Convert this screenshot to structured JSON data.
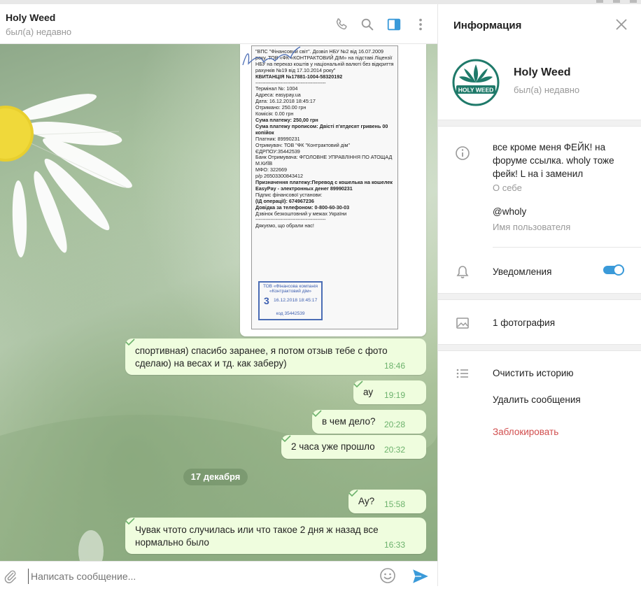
{
  "chat": {
    "title": "Holy Weed",
    "status": "был(а) недавно"
  },
  "receipt": {
    "lines": [
      "\"ВПС \"Фінансовий світ\". Дозвіл НБУ №2 від 16.07.2009 року. ТОВ «ФК «КОНТРАКТОВИЙ ДІМ» на підставі Ліцензії НБУ на переказ коштів у національній валюті без відкриття рахунків №19 від 17.10.2014 року\"",
      "КВИТАНЦІЯ №17881-1004-58320192",
      "------------------------------------------",
      "Термінал №: 1004",
      "Адреса: easypay.ua",
      "Дата: 16.12.2018 18:45:17",
      "Отримано: 250.00 грн",
      "Комісія: 0.00 грн",
      "Сума платежу: 250,00 грн",
      "Сума платежу прописом: Двісті п'ятдесят гривень 00 копійок",
      "Платник: 89990231",
      "Отримувач: ТОВ \"ФК \"Контрактовий дім\"",
      "ЄДРПОУ:35442539",
      "Банк Отримувача: ФГОЛОВНЕ УПРАВЛІННЯ ПО АТОЩАД М.КИЇВ",
      "МФО: 322669",
      "р/р 26503300843412",
      "Призначення платежу:Перевод с кошелька на кошелек EasyPay - электронных денег 89990231",
      "Підпис фінансової установи:",
      "(ІД операції): 674967236",
      "Довідка за телефоном: 0-800-60-30-03",
      "Дзвінок безкоштовний у межах України",
      "------------------------------------------",
      "Дякуємо, що обрали нас!"
    ],
    "stamp_head": "ТОВ «Фінансова компанія «Контрактовий дім»",
    "stamp_num": "3",
    "stamp_date": "16.12.2018 18:45:17",
    "stamp_code": "код 35442539"
  },
  "messages": [
    {
      "text": "спортивная) спасибо заранее, я потом отзыв тебе с фото сделаю) на весах и тд. как заберу)",
      "time": "18:46"
    },
    {
      "text": "ау",
      "time": "19:19"
    },
    {
      "text": "в чем дело?",
      "time": "20:28"
    },
    {
      "text": "2 часа уже прошло",
      "time": "20:32"
    },
    {
      "text": "Ау?",
      "time": "15:58"
    },
    {
      "text": "Чувак чтото случилась или что такое 2 дня ж назад все нормально было",
      "time": "16:33"
    }
  ],
  "date_separator": "17 декабря",
  "composer": {
    "placeholder": "Написать сообщение..."
  },
  "info": {
    "title": "Информация",
    "name": "Holy Weed",
    "status": "был(а) недавно",
    "logo_text": "HOLY WEED",
    "about": "все кроме меня ФЕЙК! на форуме ссылка. wholy тоже фейк! L на i заменил",
    "about_label": "О себе",
    "username": "@wholy",
    "username_label": "Имя пользователя",
    "notifications": "Уведомления",
    "notifications_on": true,
    "photos": "1 фотография",
    "clear_history": "Очистить историю",
    "delete_messages": "Удалить сообщения",
    "block": "Заблокировать"
  },
  "colors": {
    "accent": "#3a9ad9",
    "bubble": "#effdde",
    "time": "#6cb26c",
    "danger": "#d14e4e"
  }
}
